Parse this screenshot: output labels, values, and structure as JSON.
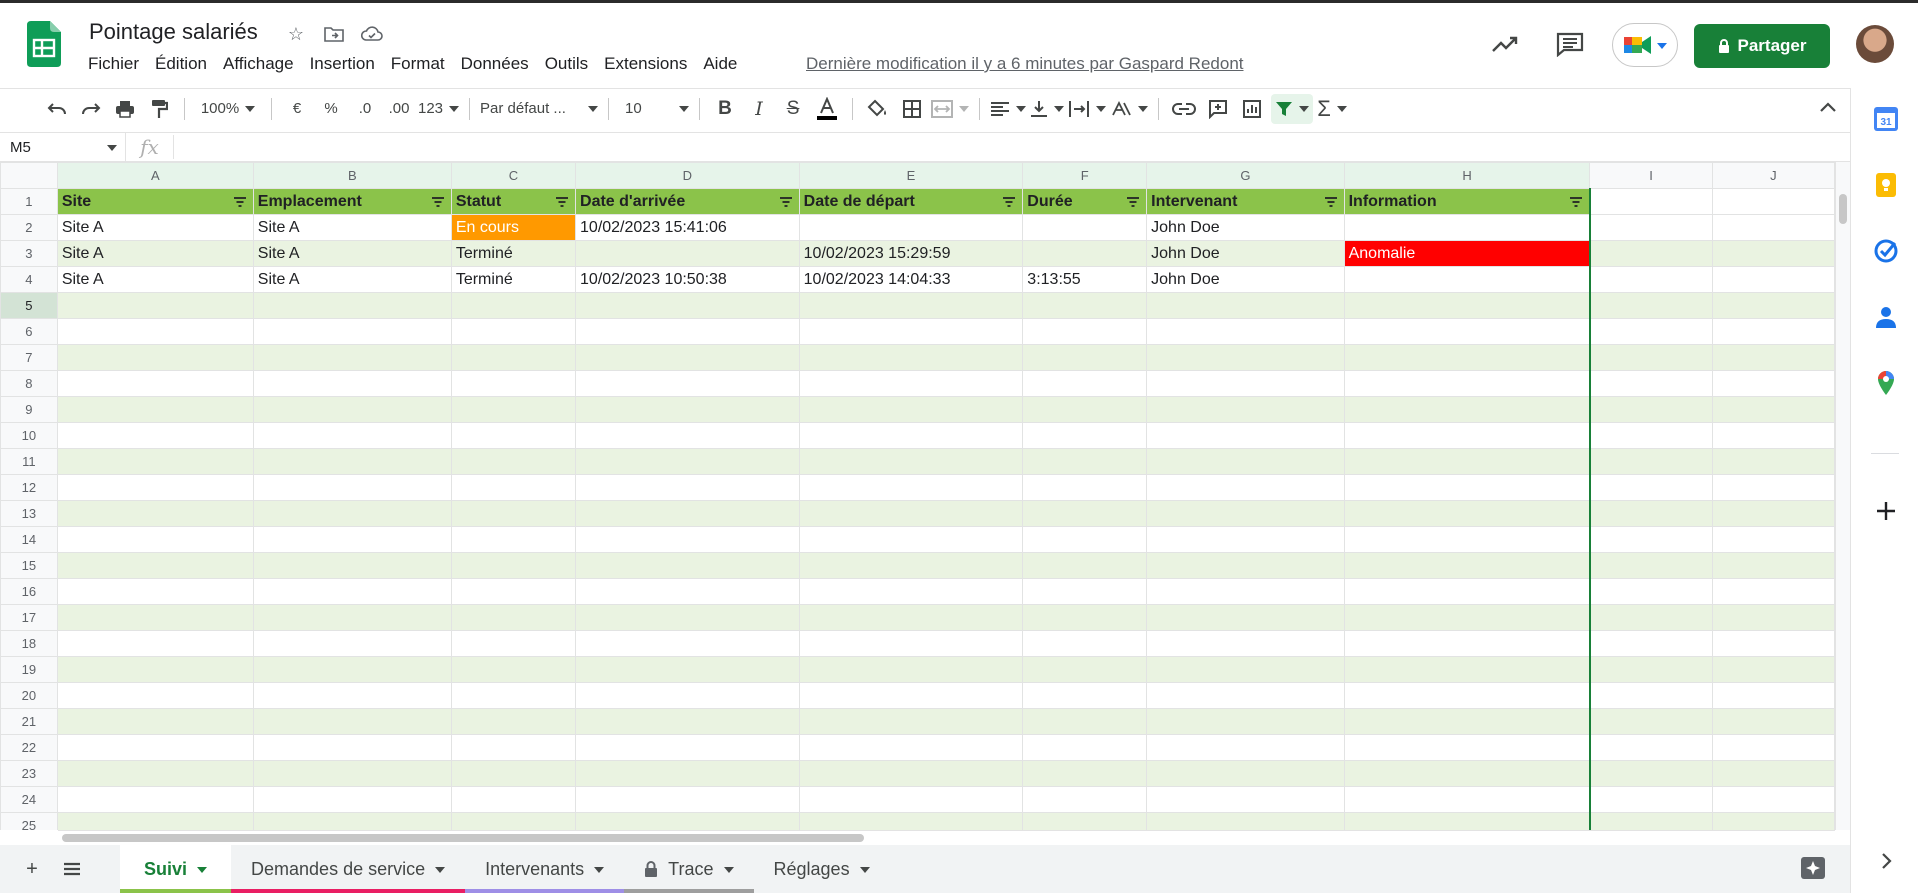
{
  "doc": {
    "title": "Pointage salariés",
    "last_edit": "Dernière modification il y a 6 minutes par Gaspard Redont"
  },
  "menu": [
    "Fichier",
    "Édition",
    "Affichage",
    "Insertion",
    "Format",
    "Données",
    "Outils",
    "Extensions",
    "Aide"
  ],
  "share_label": "Partager",
  "toolbar": {
    "zoom": "100%",
    "currency": "€",
    "percent": "%",
    "dec_less": ".0",
    "dec_more": ".00",
    "format_more": "123",
    "font": "Par défaut ...",
    "font_size": "10"
  },
  "formula_bar": {
    "cell": "M5",
    "fx": "fx",
    "value": ""
  },
  "columns": [
    "A",
    "B",
    "C",
    "D",
    "E",
    "F",
    "G",
    "H",
    "I",
    "J"
  ],
  "header_row": [
    "Site",
    "Emplacement",
    "Statut",
    "Date d'arrivée",
    "Date de départ",
    "Durée",
    "Intervenant",
    "Information"
  ],
  "rows": [
    [
      "Site A",
      "Site A",
      "En cours",
      "10/02/2023 15:41:06",
      "",
      "",
      "John Doe",
      ""
    ],
    [
      "Site A",
      "Site A",
      "Terminé",
      "",
      "10/02/2023 15:29:59",
      "",
      "John Doe",
      "Anomalie"
    ],
    [
      "Site A",
      "Site A",
      "Terminé",
      "10/02/2023 10:50:38",
      "10/02/2023 14:04:33",
      "3:13:55",
      "John Doe",
      ""
    ]
  ],
  "row_numbers": [
    "1",
    "2",
    "3",
    "4",
    "5",
    "6",
    "7",
    "8",
    "9",
    "10",
    "11",
    "12",
    "13",
    "14",
    "15",
    "16",
    "17",
    "18",
    "19",
    "20",
    "21",
    "22",
    "23",
    "24",
    "25"
  ],
  "tabs": [
    {
      "label": "Suivi",
      "color": "#8bc34a",
      "active": true
    },
    {
      "label": "Demandes de service",
      "color": "#e91e63",
      "active": false
    },
    {
      "label": "Intervenants",
      "color": "#9e8ee6",
      "active": false
    },
    {
      "label": "Trace",
      "color": "#9e9e9e",
      "active": false,
      "locked": true
    },
    {
      "label": "Réglages",
      "color": "transparent",
      "active": false
    }
  ],
  "colors": {
    "header_green": "#8bc34a",
    "band_green": "#eaf3e1",
    "status_orange": "#ff9900",
    "anomaly_red": "#ff0000",
    "share_green": "#188038"
  },
  "side_icons": [
    "calendar-icon",
    "keep-icon",
    "tasks-icon",
    "contacts-icon",
    "maps-icon",
    "add-icon"
  ]
}
